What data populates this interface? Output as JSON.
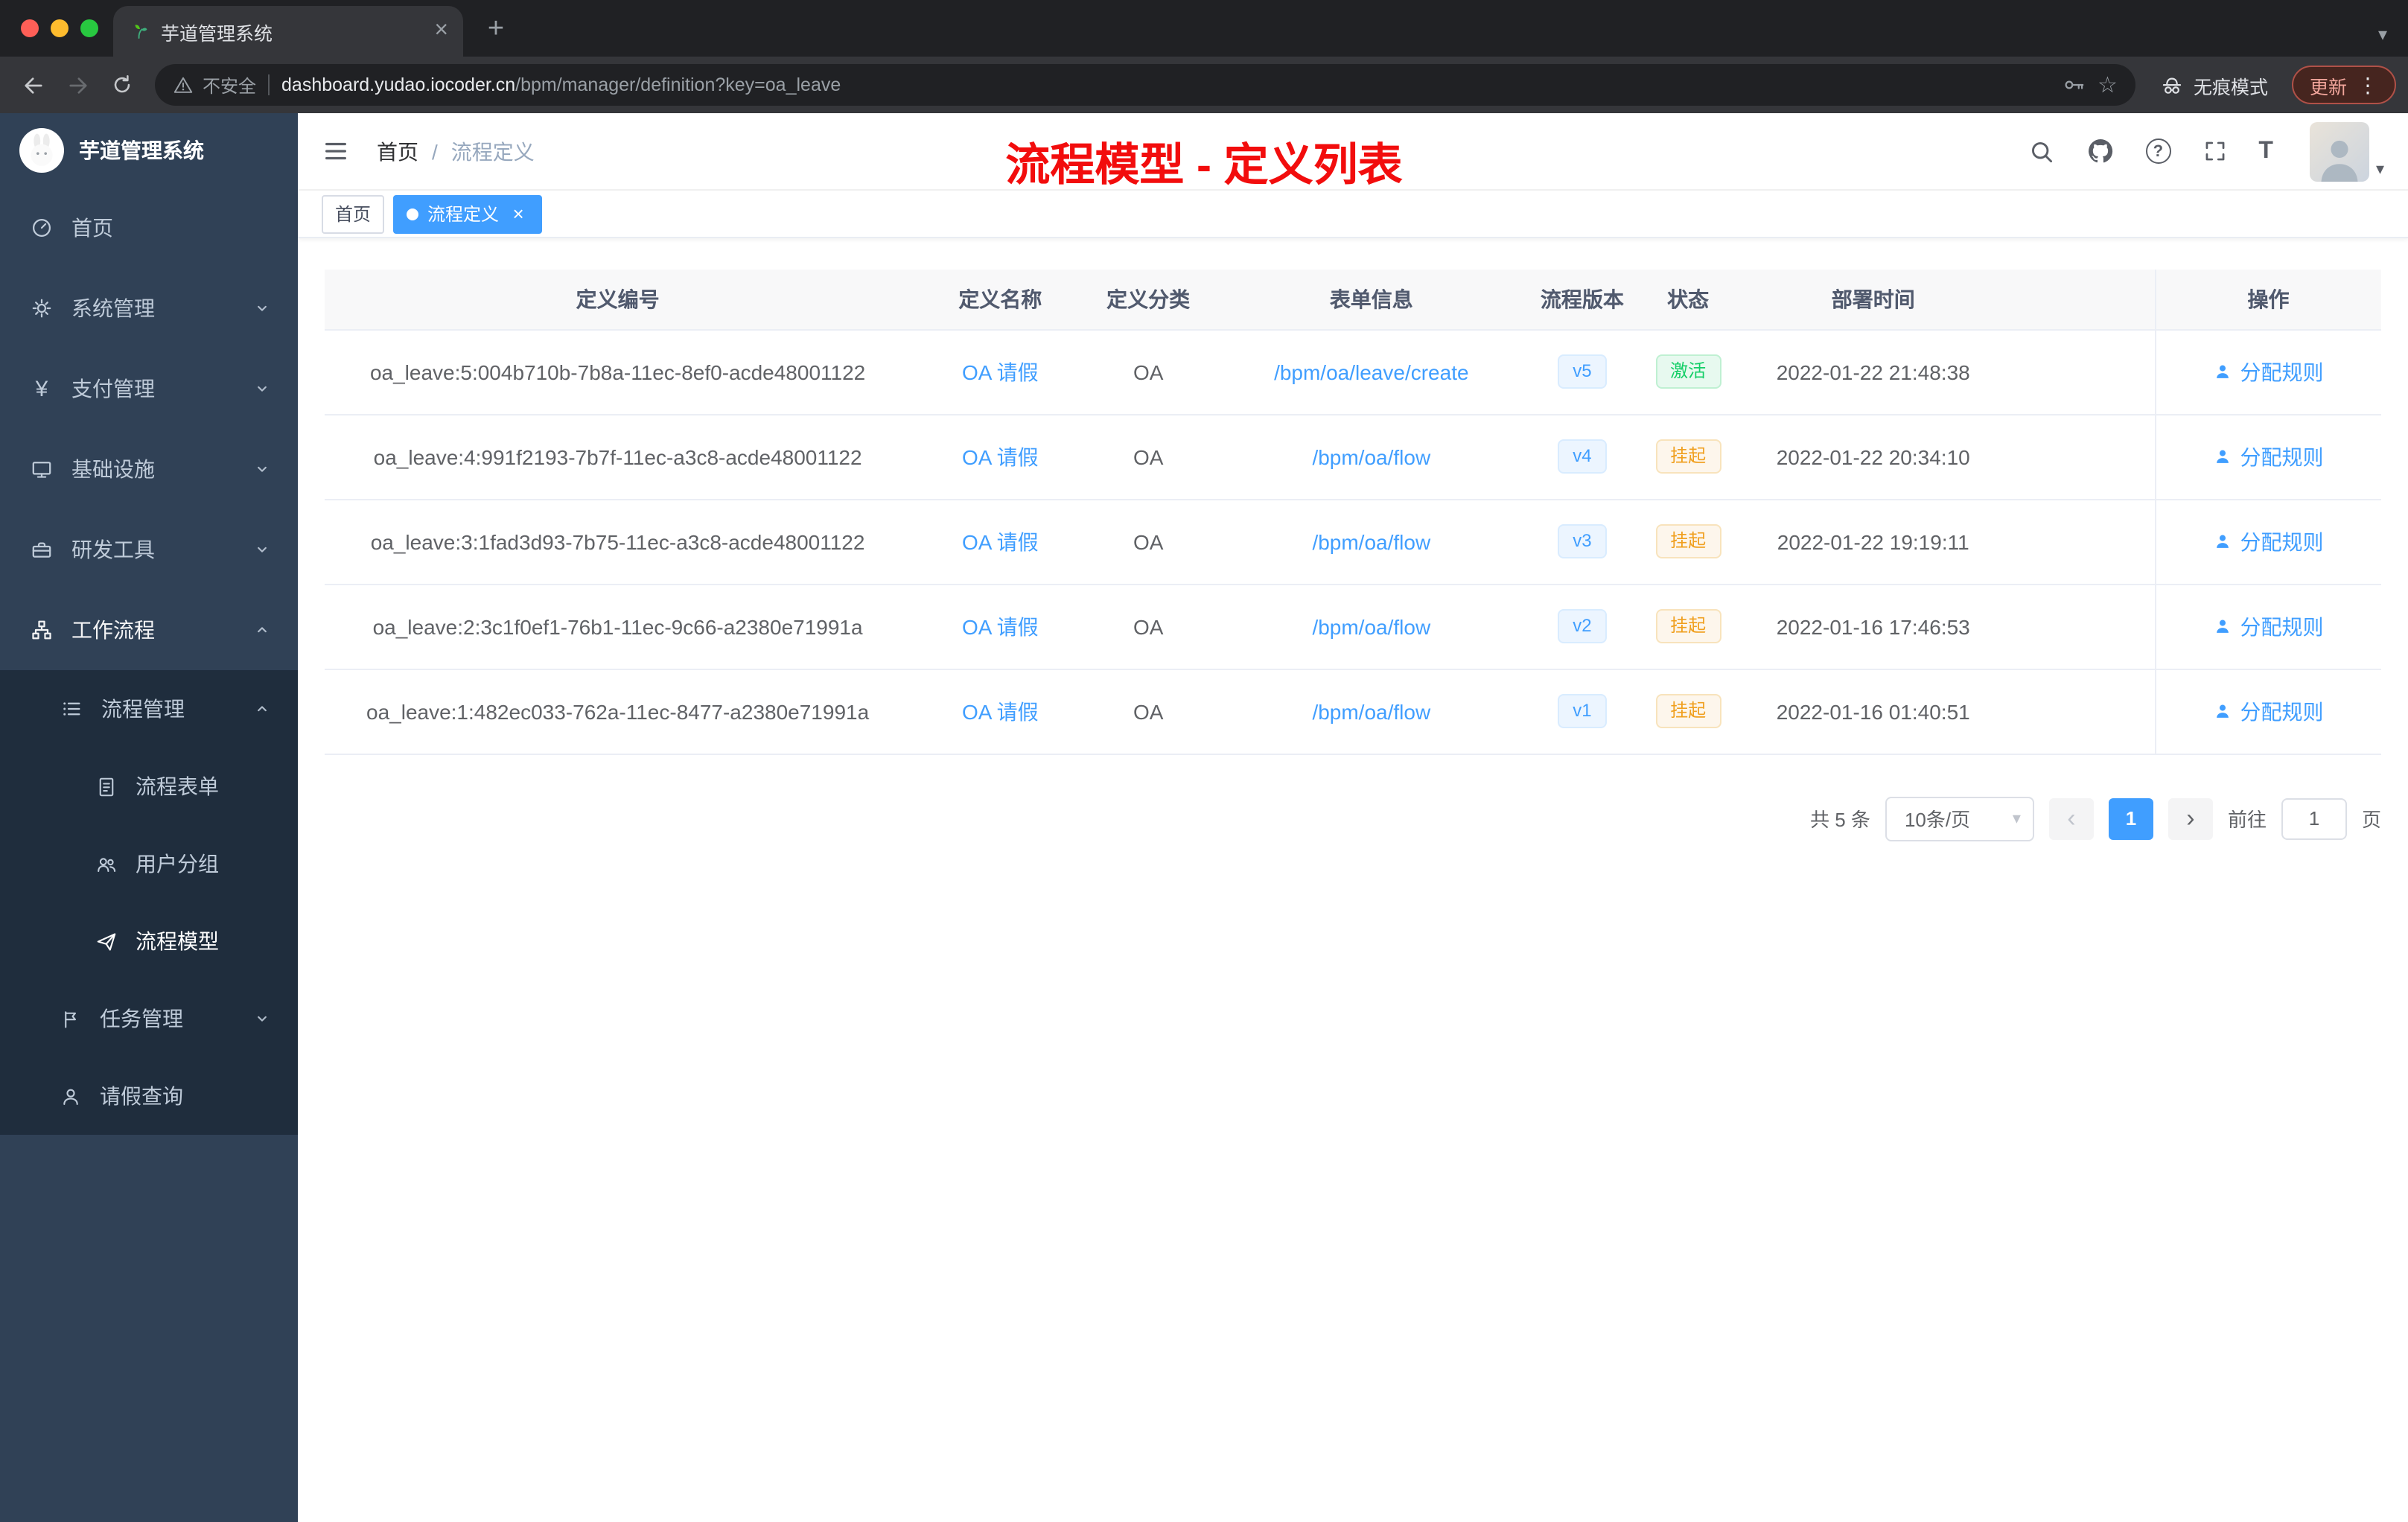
{
  "browser": {
    "tab": {
      "title": "芋道管理系统"
    },
    "address": {
      "security_label": "不安全",
      "host": "dashboard.yudao.iocoder.cn",
      "path": "/bpm/manager/definition?key=oa_leave"
    },
    "incognito_label": "无痕模式",
    "update_label": "更新"
  },
  "sidebar": {
    "brand": "芋道管理系统",
    "items": {
      "home": "首页",
      "system": "系统管理",
      "payment": "支付管理",
      "infra": "基础设施",
      "devtools": "研发工具",
      "workflow": "工作流程",
      "process_mgmt": "流程管理",
      "process_form": "流程表单",
      "user_group": "用户分组",
      "process_model": "流程模型",
      "task_mgmt": "任务管理",
      "leave_query": "请假查询"
    }
  },
  "header": {
    "breadcrumb_home": "首页",
    "breadcrumb_sep": "/",
    "breadcrumb_current": "流程定义",
    "annotation_title": "流程模型 - 定义列表"
  },
  "tags": {
    "home": "首页",
    "active": "流程定义"
  },
  "table": {
    "columns": [
      "定义编号",
      "定义名称",
      "定义分类",
      "表单信息",
      "流程版本",
      "状态",
      "部署时间",
      "操作"
    ],
    "rows": [
      {
        "id": "oa_leave:5:004b710b-7b8a-11ec-8ef0-acde48001122",
        "name": "OA 请假",
        "category": "OA",
        "form": "/bpm/oa/leave/create",
        "version": "v5",
        "status": "激活",
        "deploy_time": "2022-01-22 21:48:38",
        "action": "分配规则"
      },
      {
        "id": "oa_leave:4:991f2193-7b7f-11ec-a3c8-acde48001122",
        "name": "OA 请假",
        "category": "OA",
        "form": "/bpm/oa/flow",
        "version": "v4",
        "status": "挂起",
        "deploy_time": "2022-01-22 20:34:10",
        "action": "分配规则"
      },
      {
        "id": "oa_leave:3:1fad3d93-7b75-11ec-a3c8-acde48001122",
        "name": "OA 请假",
        "category": "OA",
        "form": "/bpm/oa/flow",
        "version": "v3",
        "status": "挂起",
        "deploy_time": "2022-01-22 19:19:11",
        "action": "分配规则"
      },
      {
        "id": "oa_leave:2:3c1f0ef1-76b1-11ec-9c66-a2380e71991a",
        "name": "OA 请假",
        "category": "OA",
        "form": "/bpm/oa/flow",
        "version": "v2",
        "status": "挂起",
        "deploy_time": "2022-01-16 17:46:53",
        "action": "分配规则"
      },
      {
        "id": "oa_leave:1:482ec033-762a-11ec-8477-a2380e71991a",
        "name": "OA 请假",
        "category": "OA",
        "form": "/bpm/oa/flow",
        "version": "v1",
        "status": "挂起",
        "deploy_time": "2022-01-16 01:40:51",
        "action": "分配规则"
      }
    ]
  },
  "pagination": {
    "total": "共 5 条",
    "page_size": "10条/页",
    "current_page": "1",
    "goto_label": "前往",
    "goto_value": "1",
    "page_unit": "页"
  },
  "icons": {
    "yen": "¥",
    "font_size": "T",
    "help": "?",
    "star": "☆",
    "plus": "+",
    "dots": "⋮",
    "prev": "‹",
    "next": "›",
    "close": "×",
    "caret_down": "▾"
  },
  "colors": {
    "accent": "#409eff",
    "success": "#13ce66",
    "warning": "#f0a020",
    "annotation": "#f20d0d",
    "sidebar_bg": "#304156",
    "submenu_bg": "#1f2d3d"
  }
}
